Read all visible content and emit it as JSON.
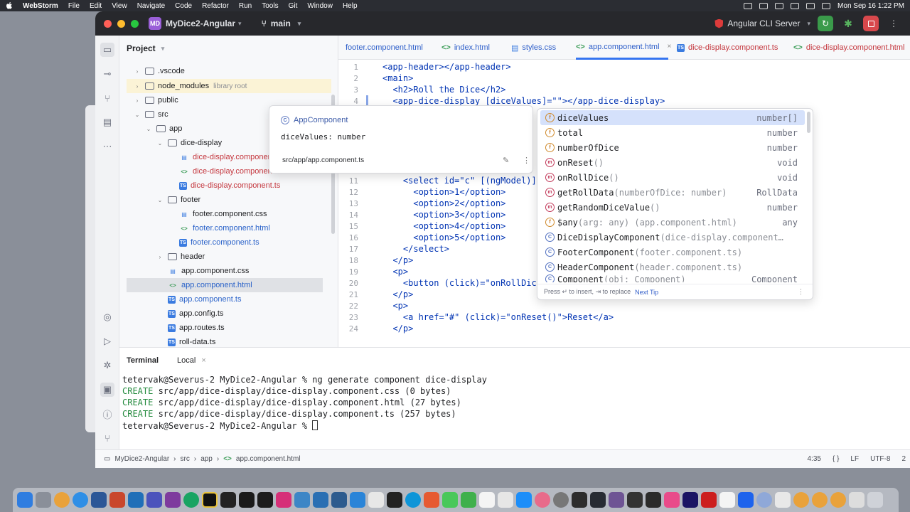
{
  "menubar": {
    "app_name": "WebStorm",
    "menus": [
      "File",
      "Edit",
      "View",
      "Navigate",
      "Code",
      "Refactor",
      "Run",
      "Tools",
      "Git",
      "Window",
      "Help"
    ],
    "clock": "Mon Sep 16  1:22 PM"
  },
  "titlebar": {
    "project_badge": "MD",
    "project_name": "MyDice2-Angular",
    "branch": "main",
    "run_config": "Angular CLI Server"
  },
  "project_panel": {
    "title": "Project",
    "rows": [
      {
        "label": ".vscode",
        "suffix": ""
      },
      {
        "label": "node_modules",
        "suffix": "library root"
      },
      {
        "label": "public",
        "suffix": ""
      },
      {
        "label": "src",
        "suffix": ""
      },
      {
        "label": "app",
        "suffix": ""
      },
      {
        "label": "dice-display",
        "suffix": ""
      },
      {
        "label": "dice-display.component.css",
        "suffix": ""
      },
      {
        "label": "dice-display.component.html",
        "suffix": ""
      },
      {
        "label": "dice-display.component.ts",
        "suffix": ""
      },
      {
        "label": "footer",
        "suffix": ""
      },
      {
        "label": "footer.component.css",
        "suffix": ""
      },
      {
        "label": "footer.component.html",
        "suffix": ""
      },
      {
        "label": "footer.component.ts",
        "suffix": ""
      },
      {
        "label": "header",
        "suffix": ""
      },
      {
        "label": "app.component.css",
        "suffix": ""
      },
      {
        "label": "app.component.html",
        "suffix": ""
      },
      {
        "label": "app.component.ts",
        "suffix": ""
      },
      {
        "label": "app.config.ts",
        "suffix": ""
      },
      {
        "label": "app.routes.ts",
        "suffix": ""
      },
      {
        "label": "roll-data.ts",
        "suffix": ""
      }
    ]
  },
  "tabs": [
    {
      "label": "footer.component.html"
    },
    {
      "label": "index.html"
    },
    {
      "label": "styles.css"
    },
    {
      "label": "app.component.html"
    },
    {
      "label": "dice-display.component.ts"
    },
    {
      "label": "dice-display.component.html"
    }
  ],
  "editor": {
    "line_numbers": [
      "1",
      "2",
      "3",
      "4",
      "11",
      "12",
      "13",
      "14",
      "15",
      "16",
      "17",
      "18",
      "19",
      "20",
      "21",
      "22",
      "23",
      "24"
    ],
    "lines": [
      "<app-header></app-header>",
      "<main>",
      "  <h2>Roll the Dice</h2>",
      "  <app-dice-display [diceValues]=\"\"></app-dice-display>",
      "    <select id=\"c\" [(ngModel)]",
      "      <option>1</option>",
      "      <option>2</option>",
      "      <option>3</option>",
      "      <option>4</option>",
      "      <option>5</option>",
      "    </select>",
      "  </p>",
      "  <p>",
      "    <button (click)=\"onRollDice",
      "  </p>",
      "  <p>",
      "    <a href=\"#\" (click)=\"onReset()\">Reset</a>",
      "  </p>"
    ]
  },
  "quick_doc": {
    "class_name": "AppComponent",
    "signature": "diceValues: number",
    "path": "src/app/app.component.ts"
  },
  "completion": {
    "items": [
      {
        "kind": "f",
        "name": "diceValues",
        "tail": "",
        "type": "number[]"
      },
      {
        "kind": "f",
        "name": "total",
        "tail": "",
        "type": "number"
      },
      {
        "kind": "f",
        "name": "numberOfDice",
        "tail": "",
        "type": "number"
      },
      {
        "kind": "m",
        "name": "onReset",
        "tail": "()",
        "type": "void"
      },
      {
        "kind": "m",
        "name": "onRollDice",
        "tail": "()",
        "type": "void"
      },
      {
        "kind": "m",
        "name": "getRollData",
        "tail": "(numberOfDice: number)",
        "type": "RollData"
      },
      {
        "kind": "m",
        "name": "getRandomDiceValue",
        "tail": "()",
        "type": "number"
      },
      {
        "kind": "f",
        "name": "$any",
        "tail": "(arg: any) (app.component.html)",
        "type": "any"
      },
      {
        "kind": "c",
        "name": "DiceDisplayComponent",
        "tail": " (dice-display.component…",
        "type": ""
      },
      {
        "kind": "c",
        "name": "FooterComponent",
        "tail": " (footer.component.ts)",
        "type": ""
      },
      {
        "kind": "c",
        "name": "HeaderComponent",
        "tail": " (header.component.ts)",
        "type": ""
      },
      {
        "kind": "c",
        "name": "Component",
        "tail": "(obj: Component)",
        "type": "Component"
      }
    ],
    "footer_text": "Press ↵ to insert, ⇥ to replace",
    "footer_tip": "Next Tip"
  },
  "terminal": {
    "tab_title": "Terminal",
    "tab_local": "Local",
    "lines": [
      {
        "prefix": "",
        "text": "tetervak@Severus-2 MyDice2-Angular % ng generate component dice-display"
      },
      {
        "prefix": "CREATE",
        "text": " src/app/dice-display/dice-display.component.css (0 bytes)"
      },
      {
        "prefix": "CREATE",
        "text": " src/app/dice-display/dice-display.component.html (27 bytes)"
      },
      {
        "prefix": "CREATE",
        "text": " src/app/dice-display/dice-display.component.ts (257 bytes)"
      },
      {
        "prefix": "",
        "text": "tetervak@Severus-2 MyDice2-Angular % "
      }
    ]
  },
  "statusbar": {
    "crumbs": [
      "MyDice2-Angular",
      "src",
      "app",
      "app.component.html"
    ],
    "position": "4:35",
    "braces": "{ }",
    "line_sep": "LF",
    "encoding": "UTF-8",
    "indent": "2"
  },
  "colors": {
    "accent": "#3574f0",
    "titlebar_bg": "#27282c",
    "string_green": "#067d17",
    "create_green": "#238a3d"
  }
}
